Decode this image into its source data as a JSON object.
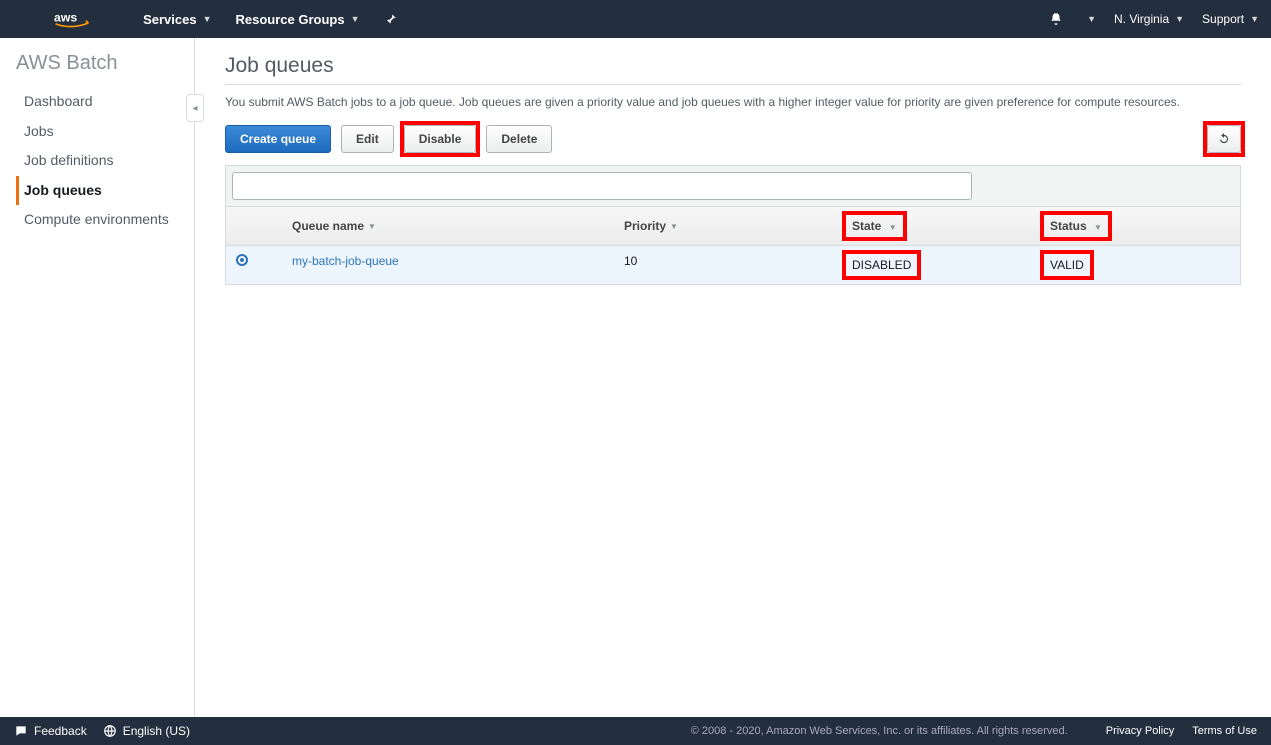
{
  "topnav": {
    "services": "Services",
    "resource_groups": "Resource Groups",
    "region": "N. Virginia",
    "support": "Support"
  },
  "sidebar": {
    "title": "AWS Batch",
    "items": [
      {
        "label": "Dashboard",
        "active": false
      },
      {
        "label": "Jobs",
        "active": false
      },
      {
        "label": "Job definitions",
        "active": false
      },
      {
        "label": "Job queues",
        "active": true
      },
      {
        "label": "Compute environments",
        "active": false
      }
    ]
  },
  "page": {
    "title": "Job queues",
    "description": "You submit AWS Batch jobs to a job queue. Job queues are given a priority value and job queues with a higher integer value for priority are given preference for compute resources."
  },
  "toolbar": {
    "create": "Create queue",
    "edit": "Edit",
    "disable": "Disable",
    "delete": "Delete"
  },
  "table": {
    "headers": {
      "name": "Queue name",
      "priority": "Priority",
      "state": "State",
      "status": "Status"
    },
    "rows": [
      {
        "name": "my-batch-job-queue",
        "priority": "10",
        "state": "DISABLED",
        "status": "VALID"
      }
    ],
    "filter_placeholder": ""
  },
  "footer": {
    "feedback": "Feedback",
    "language": "English (US)",
    "copyright": "© 2008 - 2020, Amazon Web Services, Inc. or its affiliates. All rights reserved.",
    "privacy": "Privacy Policy",
    "terms": "Terms of Use"
  }
}
